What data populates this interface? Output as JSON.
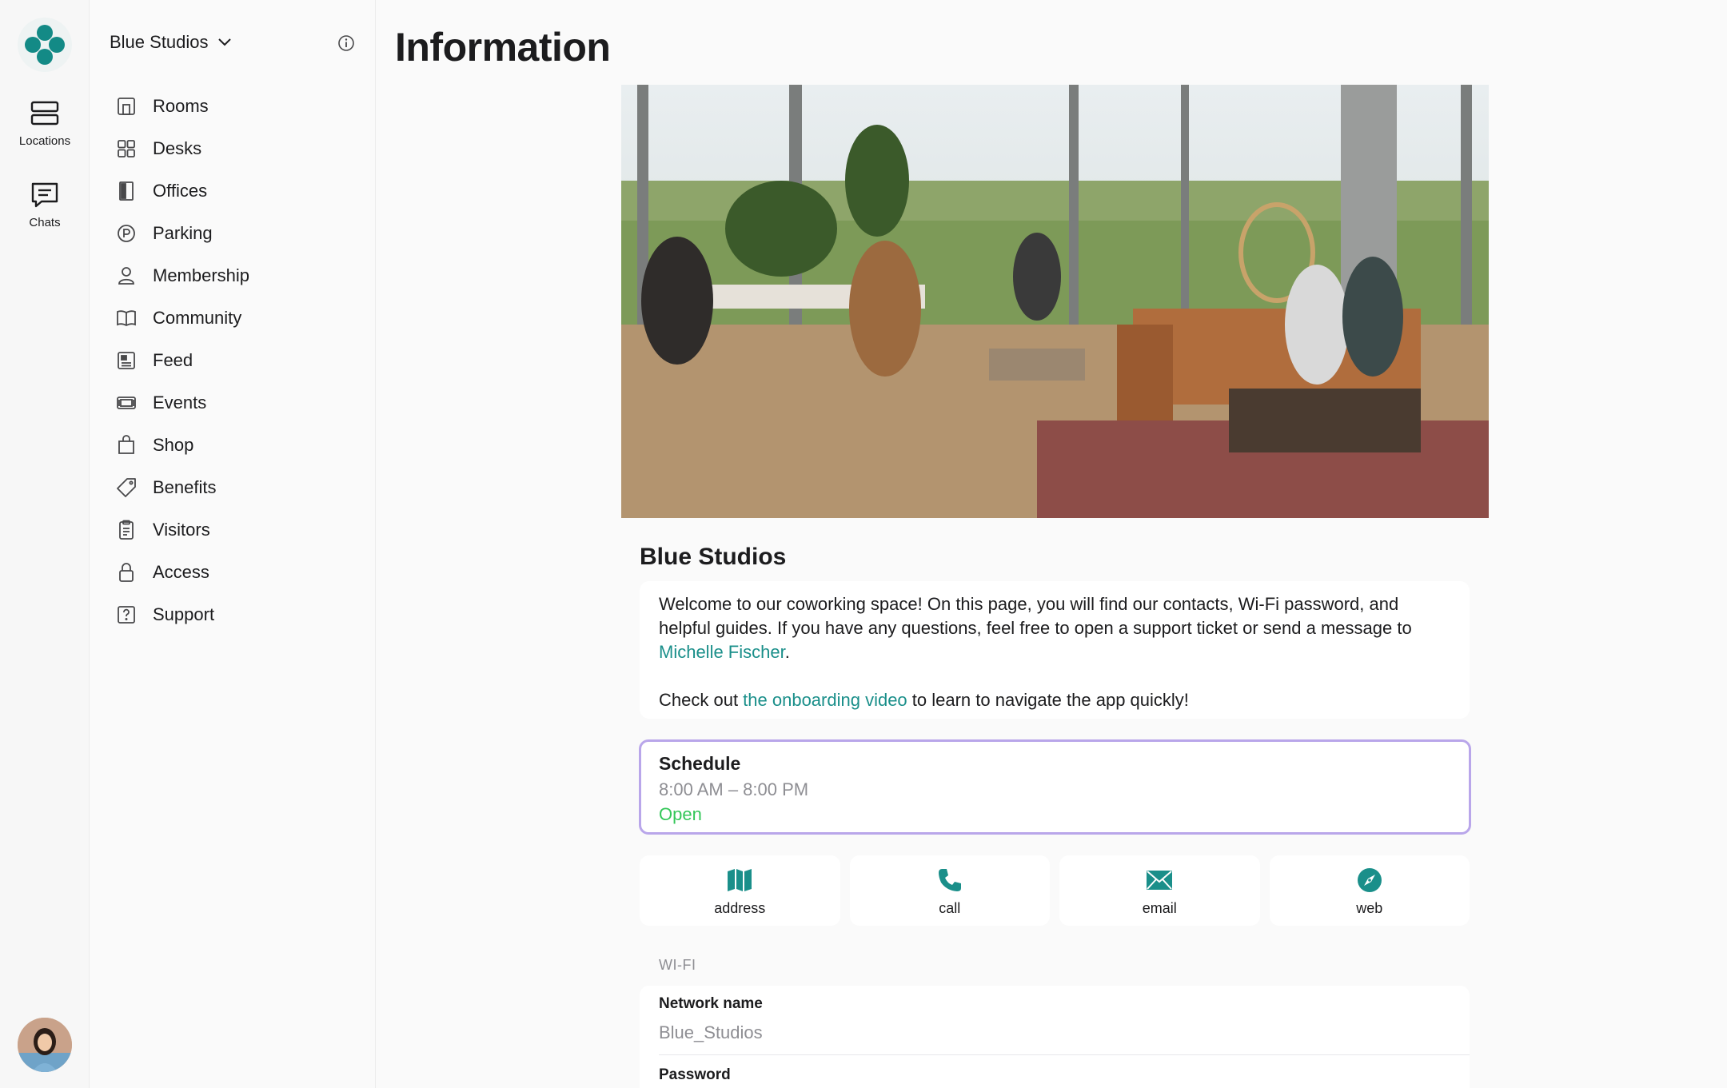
{
  "rail": {
    "items": [
      {
        "label": "Locations",
        "icon": "locations-icon"
      },
      {
        "label": "Chats",
        "icon": "chats-icon"
      }
    ]
  },
  "sidebar": {
    "workspace": "Blue Studios",
    "items": [
      {
        "label": "Rooms",
        "icon": "rooms-icon"
      },
      {
        "label": "Desks",
        "icon": "desks-icon"
      },
      {
        "label": "Offices",
        "icon": "offices-icon"
      },
      {
        "label": "Parking",
        "icon": "parking-icon"
      },
      {
        "label": "Membership",
        "icon": "membership-icon"
      },
      {
        "label": "Community",
        "icon": "community-icon"
      },
      {
        "label": "Feed",
        "icon": "feed-icon"
      },
      {
        "label": "Events",
        "icon": "events-icon"
      },
      {
        "label": "Shop",
        "icon": "shop-icon"
      },
      {
        "label": "Benefits",
        "icon": "benefits-icon"
      },
      {
        "label": "Visitors",
        "icon": "visitors-icon"
      },
      {
        "label": "Access",
        "icon": "access-icon"
      },
      {
        "label": "Support",
        "icon": "support-icon"
      }
    ]
  },
  "main": {
    "title": "Information",
    "location_name": "Blue Studios",
    "welcome": {
      "text_1": "Welcome to our coworking space! On this page, you will find our contacts, Wi-Fi password, and helpful guides. If you have any questions, feel free to open a support ticket or send a message to ",
      "contact_link": "Michelle Fischer",
      "text_2": ".",
      "text_3": "Check out ",
      "video_link": "the onboarding video",
      "text_4": " to learn to navigate the app quickly!"
    },
    "schedule": {
      "title": "Schedule",
      "hours": "8:00 AM – 8:00 PM",
      "status": "Open"
    },
    "actions": [
      {
        "label": "address",
        "icon": "map-icon"
      },
      {
        "label": "call",
        "icon": "phone-icon"
      },
      {
        "label": "email",
        "icon": "envelope-icon"
      },
      {
        "label": "web",
        "icon": "compass-icon"
      }
    ],
    "wifi": {
      "header": "WI-FI",
      "network_label": "Network name",
      "network_value": "Blue_Studios",
      "password_label": "Password"
    }
  },
  "colors": {
    "accent": "#1a8f8a",
    "open": "#34c759",
    "schedule_border": "#b9a6ea"
  }
}
